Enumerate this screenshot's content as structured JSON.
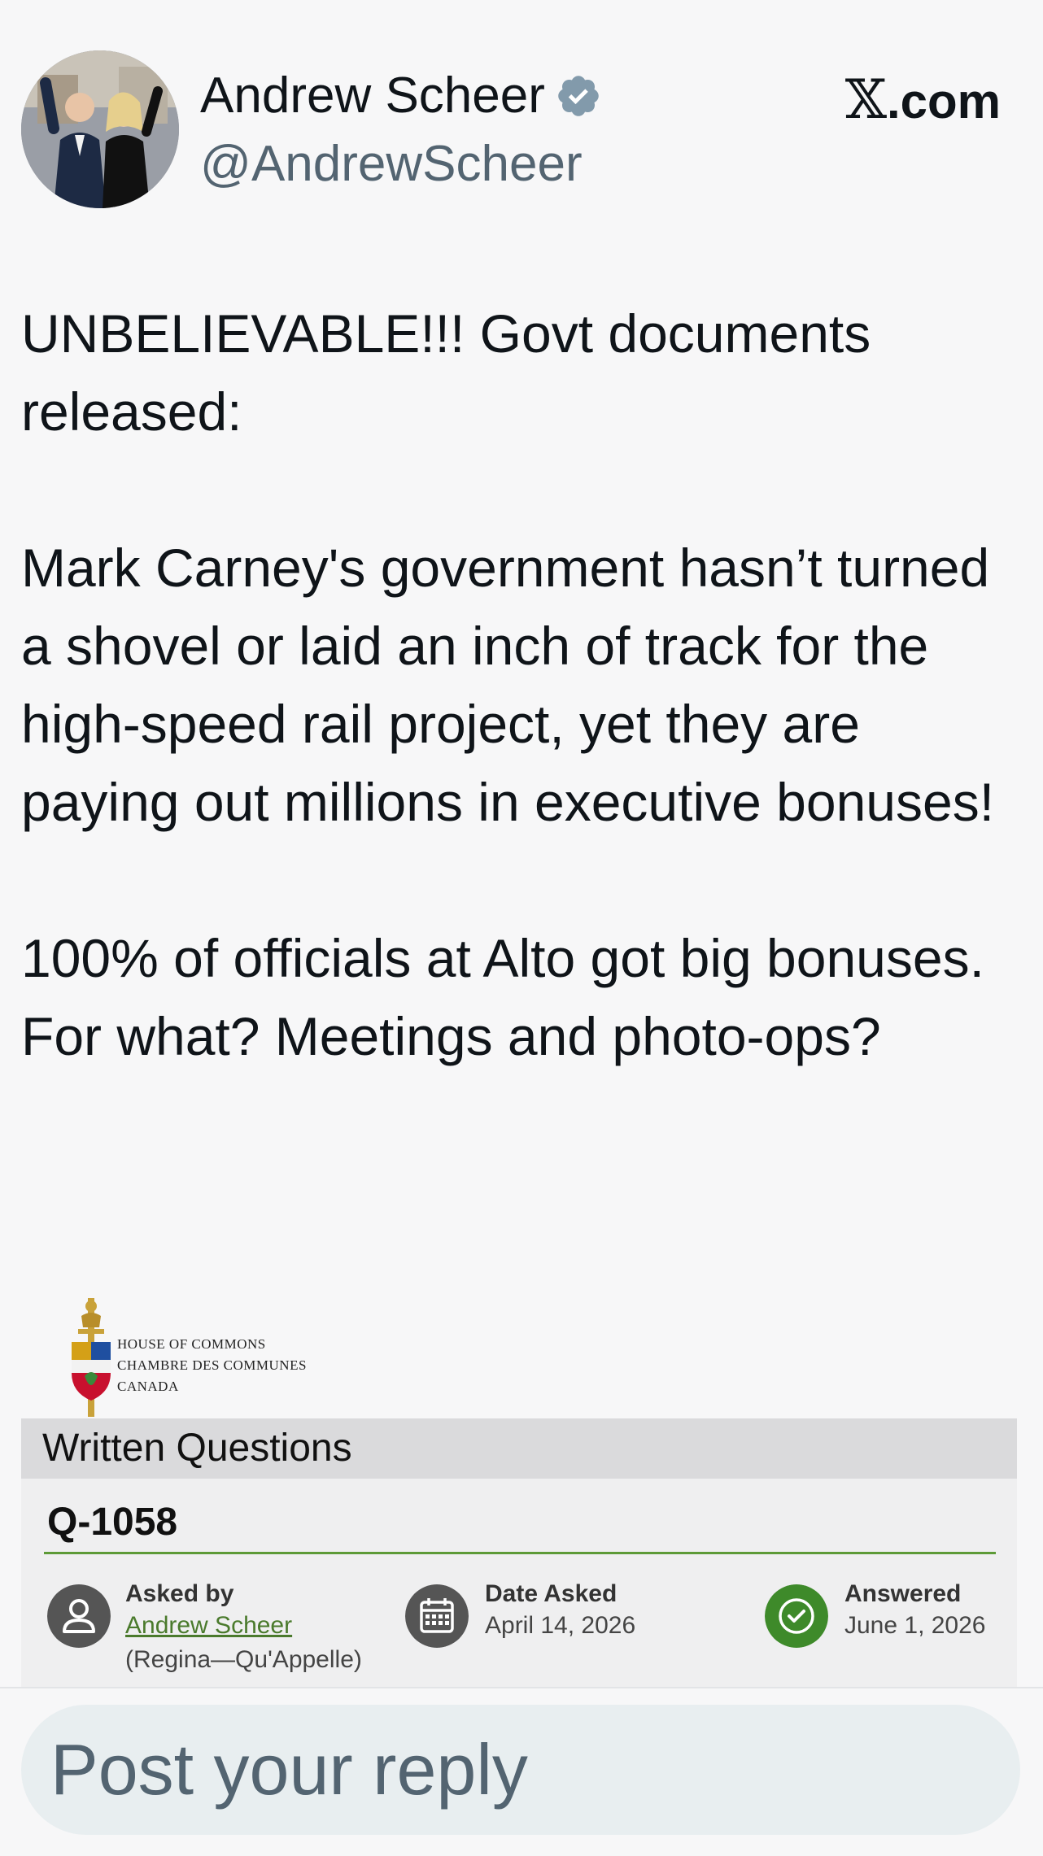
{
  "header": {
    "display_name": "Andrew Scheer",
    "handle": "@AndrewScheer",
    "site_label_x": "𝕏",
    "site_label_rest": ".com",
    "verified_icon": "verified-badge-icon",
    "colors": {
      "verified": "#829aab",
      "handle": "#536471"
    }
  },
  "tweet": {
    "paragraphs": [
      "UNBELIEVABLE!!! Govt documents released:",
      "Mark Carney's government hasn’t turned a shovel or laid an inch of track for the high-speed rail project, yet they are paying out millions in executive bonuses!",
      "100% of officials at Alto got big bonuses. For what? Meetings and photo-ops?"
    ]
  },
  "attachment": {
    "institution_lines": [
      "HOUSE OF COMMONS",
      "CHAMBRE DES COMMUNES",
      "CANADA"
    ],
    "section_title": "Written Questions",
    "question_number": "Q-1058",
    "asked_by_label": "Asked by",
    "asked_by_name": "Andrew Scheer",
    "asked_by_riding": "(Regina—Qu'Appelle)",
    "date_asked_label": "Date Asked",
    "date_asked_value": "April 14, 2026",
    "answered_label": "Answered",
    "answered_value": "June 1, 2026",
    "icons": [
      "person-icon",
      "calendar-icon",
      "check-circle-icon",
      "parliament-crest-icon"
    ],
    "colors": {
      "rule": "#5d9a37",
      "answered_icon": "#3e8a2a",
      "neutral_icon": "#555555",
      "link": "#4a7a2c"
    }
  },
  "reply": {
    "placeholder": "Post your reply"
  }
}
